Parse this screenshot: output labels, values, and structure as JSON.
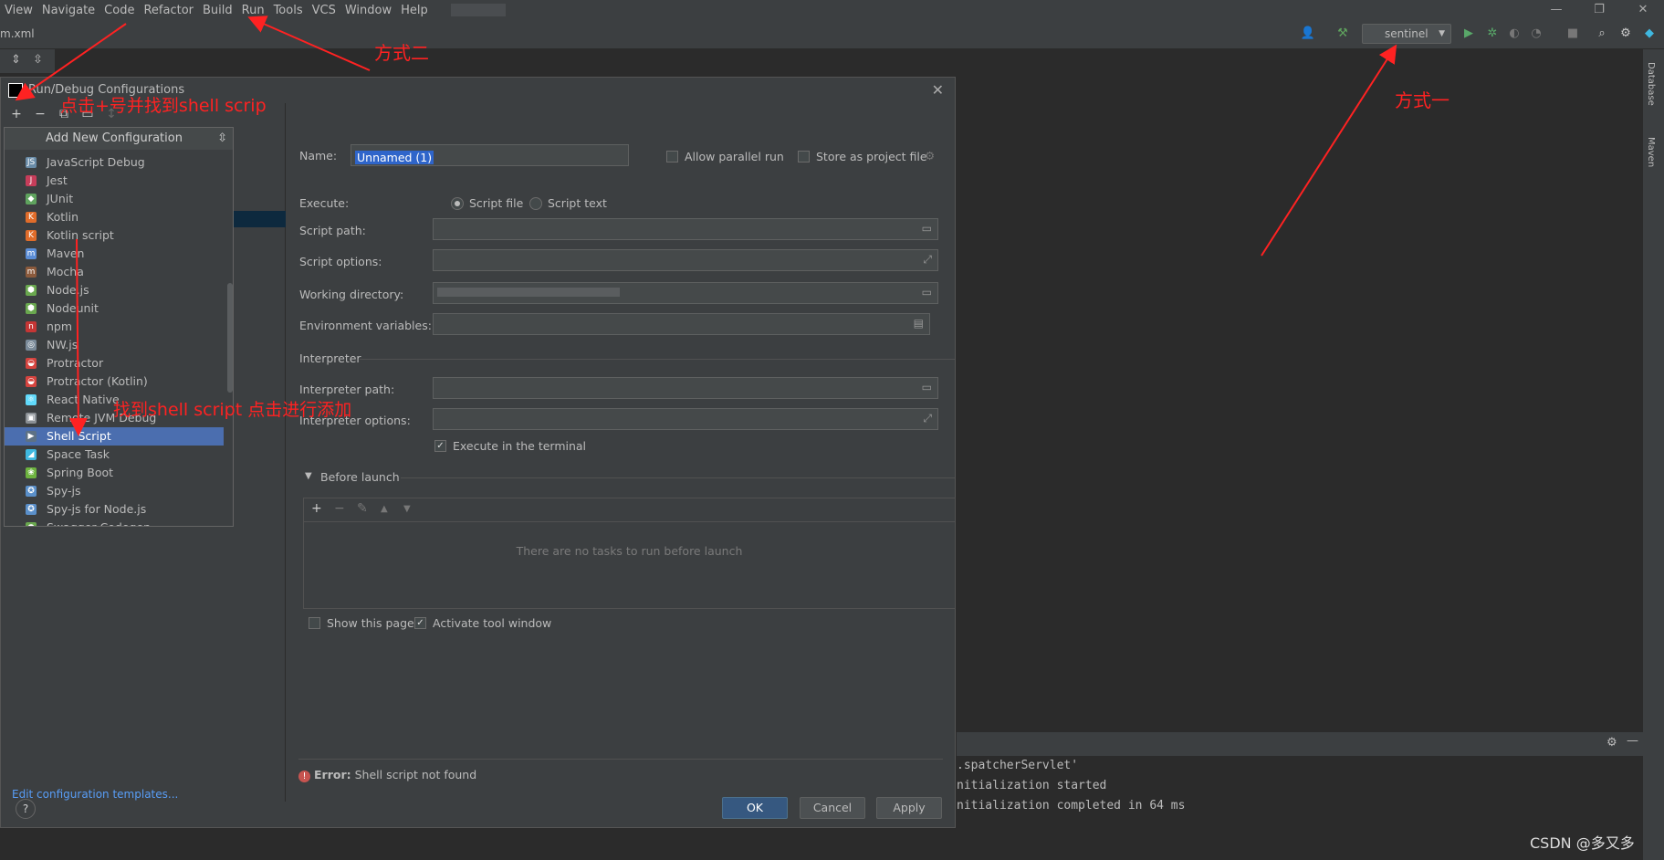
{
  "menu": [
    "View",
    "Navigate",
    "Code",
    "Refactor",
    "Build",
    "Run",
    "Tools",
    "VCS",
    "Window",
    "Help"
  ],
  "toolbar": {
    "file_tab": "m.xml",
    "run_config": "sentinel"
  },
  "right_strip": {
    "database": "Database",
    "maven": "Maven"
  },
  "dialog": {
    "title": "Run/Debug Configurations",
    "popup_title": "Add New Configuration",
    "items": [
      {
        "label": "JavaScript Debug",
        "icon": "js-debug-icon",
        "color": "#6a8ca8",
        "glyph": "JS"
      },
      {
        "label": "Jest",
        "icon": "jest-icon",
        "color": "#c63d5a",
        "glyph": "J"
      },
      {
        "label": "JUnit",
        "icon": "junit-icon",
        "color": "#5fa35e",
        "glyph": "◆"
      },
      {
        "label": "Kotlin",
        "icon": "kotlin-icon",
        "color": "#e06c2a",
        "glyph": "K"
      },
      {
        "label": "Kotlin script",
        "icon": "kotlin-script-icon",
        "color": "#e06c2a",
        "glyph": "K"
      },
      {
        "label": "Maven",
        "icon": "maven-icon",
        "color": "#5b8dd6",
        "glyph": "m"
      },
      {
        "label": "Mocha",
        "icon": "mocha-icon",
        "color": "#8b5a3c",
        "glyph": "m"
      },
      {
        "label": "Node.js",
        "icon": "nodejs-icon",
        "color": "#6aa84f",
        "glyph": "⬢"
      },
      {
        "label": "Nodeunit",
        "icon": "nodeunit-icon",
        "color": "#6aa84f",
        "glyph": "⬢"
      },
      {
        "label": "npm",
        "icon": "npm-icon",
        "color": "#c53635",
        "glyph": "n"
      },
      {
        "label": "NW.js",
        "icon": "nwjs-icon",
        "color": "#7a8a99",
        "glyph": "◎"
      },
      {
        "label": "Protractor",
        "icon": "protractor-icon",
        "color": "#d5443f",
        "glyph": "◒"
      },
      {
        "label": "Protractor (Kotlin)",
        "icon": "protractor-kotlin-icon",
        "color": "#d5443f",
        "glyph": "◒"
      },
      {
        "label": "React Native",
        "icon": "react-native-icon",
        "color": "#61dafb",
        "glyph": "⚛"
      },
      {
        "label": "Remote JVM Debug",
        "icon": "remote-jvm-debug-icon",
        "color": "#8a8f94",
        "glyph": "▣"
      },
      {
        "label": "Shell Script",
        "icon": "shell-script-icon",
        "color": "#5d7185",
        "glyph": "▶"
      },
      {
        "label": "Space Task",
        "icon": "space-task-icon",
        "color": "#3fb8e0",
        "glyph": "◢"
      },
      {
        "label": "Spring Boot",
        "icon": "spring-boot-icon",
        "color": "#6db33f",
        "glyph": "❀"
      },
      {
        "label": "Spy-js",
        "icon": "spy-js-icon",
        "color": "#5a8fc9",
        "glyph": "✪"
      },
      {
        "label": "Spy-js for Node.js",
        "icon": "spy-js-node-icon",
        "color": "#5a8fc9",
        "glyph": "✪"
      },
      {
        "label": "Swagger Codegen",
        "icon": "swagger-icon",
        "color": "#6aa84f",
        "glyph": "●"
      }
    ],
    "edit_templates": "Edit configuration templates...",
    "form": {
      "name_label": "Name:",
      "name_value": "Unnamed (1)",
      "allow_parallel": "Allow parallel run",
      "store_as_project": "Store as project file",
      "execute_label": "Execute:",
      "script_file": "Script file",
      "script_text": "Script text",
      "script_path": "Script path:",
      "script_options": "Script options:",
      "working_dir": "Working directory:",
      "env_vars": "Environment variables:",
      "interpreter_section": "Interpreter",
      "interpreter_path": "Interpreter path:",
      "interpreter_options": "Interpreter options:",
      "execute_in_terminal": "Execute in the terminal",
      "before_launch": "Before launch",
      "no_tasks": "There are no tasks to run before launch",
      "show_page": "Show this page",
      "activate_tool": "Activate tool window"
    },
    "error_label": "Error:",
    "error_text": "Shell script not found",
    "buttons": {
      "ok": "OK",
      "cancel": "Cancel",
      "apply": "Apply"
    },
    "help": "?"
  },
  "console": [
    ".spatcherServlet'",
    "nitialization started",
    "nitialization completed in 64 ms"
  ],
  "annotations": {
    "way_two": "方式二",
    "way_one": "方式一",
    "click_plus": "点击+号并找到shell scrip",
    "find_shell": "找到shell script 点击进行添加"
  },
  "watermark": "CSDN @多又多",
  "colors": {
    "annotation": "#ff2222",
    "selection": "#4b6eaf",
    "primary_button": "#365880"
  }
}
